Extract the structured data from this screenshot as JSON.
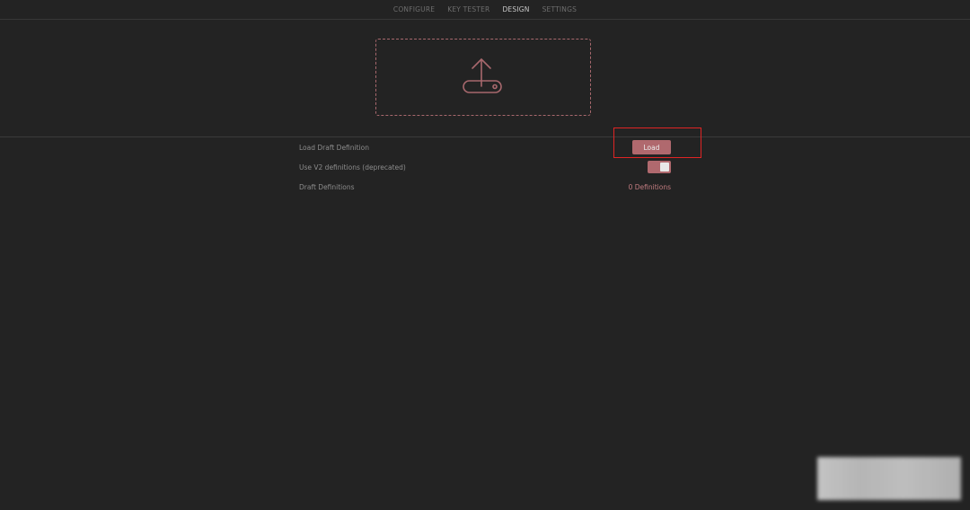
{
  "nav": {
    "tabs": [
      {
        "label": "CONFIGURE",
        "active": false
      },
      {
        "label": "KEY TESTER",
        "active": false
      },
      {
        "label": "DESIGN",
        "active": true
      },
      {
        "label": "SETTINGS",
        "active": false
      }
    ]
  },
  "dropzone": {
    "icon": "upload-icon"
  },
  "settings": {
    "load_draft_label": "Load Draft Definition",
    "load_button_label": "Load",
    "v2_label": "Use V2 definitions (deprecated)",
    "v2_enabled": true,
    "draft_defs_label": "Draft Definitions",
    "draft_defs_count": "0 Definitions"
  },
  "colors": {
    "background": "#232323",
    "accent": "#b0696e",
    "accent_text": "#c27c80",
    "highlight": "#e02424"
  }
}
